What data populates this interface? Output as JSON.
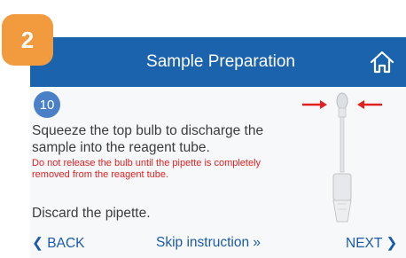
{
  "badge": "2",
  "header": {
    "title": "Sample Preparation",
    "home_icon": "home-icon"
  },
  "step": {
    "number": "10"
  },
  "instruction": {
    "main": "Squeeze the top bulb to discharge the sample into the reagent tube.",
    "warning": "Do not release the bulb until the pipette is completely removed from the reagent tube.",
    "discard": "Discard the pipette."
  },
  "nav": {
    "back": "❮ BACK",
    "skip": "Skip instruction »",
    "next": "NEXT ❯"
  },
  "colors": {
    "header": "#1b63ad",
    "badge": "#f19a3e",
    "warning": "#e32020",
    "link": "#1b5aa8"
  }
}
